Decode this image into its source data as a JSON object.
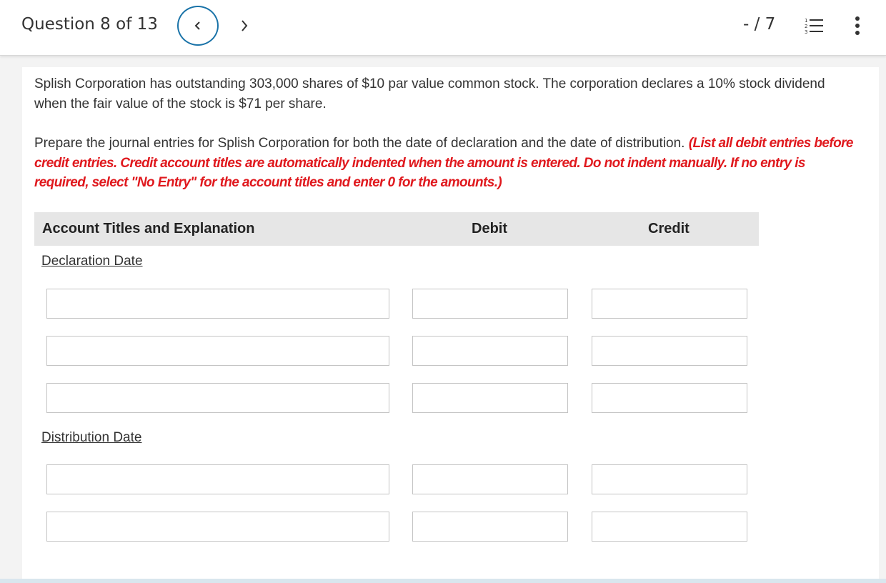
{
  "header": {
    "question_label": "Question 8 of 13",
    "score": "- / 7",
    "prev_icon": "chevron-left-icon",
    "next_icon": "chevron-right-icon",
    "list_icon": "numbered-list-icon",
    "more_icon": "vertical-ellipsis-icon",
    "accent_color": "#1a73a8"
  },
  "problem": {
    "text": "Splish Corporation has outstanding 303,000 shares of $10 par value common stock. The corporation declares a 10% stock dividend when the fair value of the stock is $71 per share."
  },
  "instructions": {
    "text": "Prepare the journal entries for Splish Corporation for both the date of declaration and the date of distribution.",
    "note": "(List all debit entries before credit entries. Credit account titles are automatically indented when the amount is entered. Do not indent manually. If no entry is required, select \"No Entry\" for the account titles and enter 0 for the amounts.)",
    "note_color": "#e0191e"
  },
  "table": {
    "headers": {
      "account": "Account Titles and Explanation",
      "debit": "Debit",
      "credit": "Credit"
    },
    "sections": [
      {
        "title": "Declaration Date",
        "rows": [
          {
            "account": "",
            "debit": "",
            "credit": ""
          },
          {
            "account": "",
            "debit": "",
            "credit": ""
          },
          {
            "account": "",
            "debit": "",
            "credit": ""
          }
        ]
      },
      {
        "title": "Distribution Date",
        "rows": [
          {
            "account": "",
            "debit": "",
            "credit": ""
          },
          {
            "account": "",
            "debit": "",
            "credit": ""
          }
        ]
      }
    ]
  }
}
